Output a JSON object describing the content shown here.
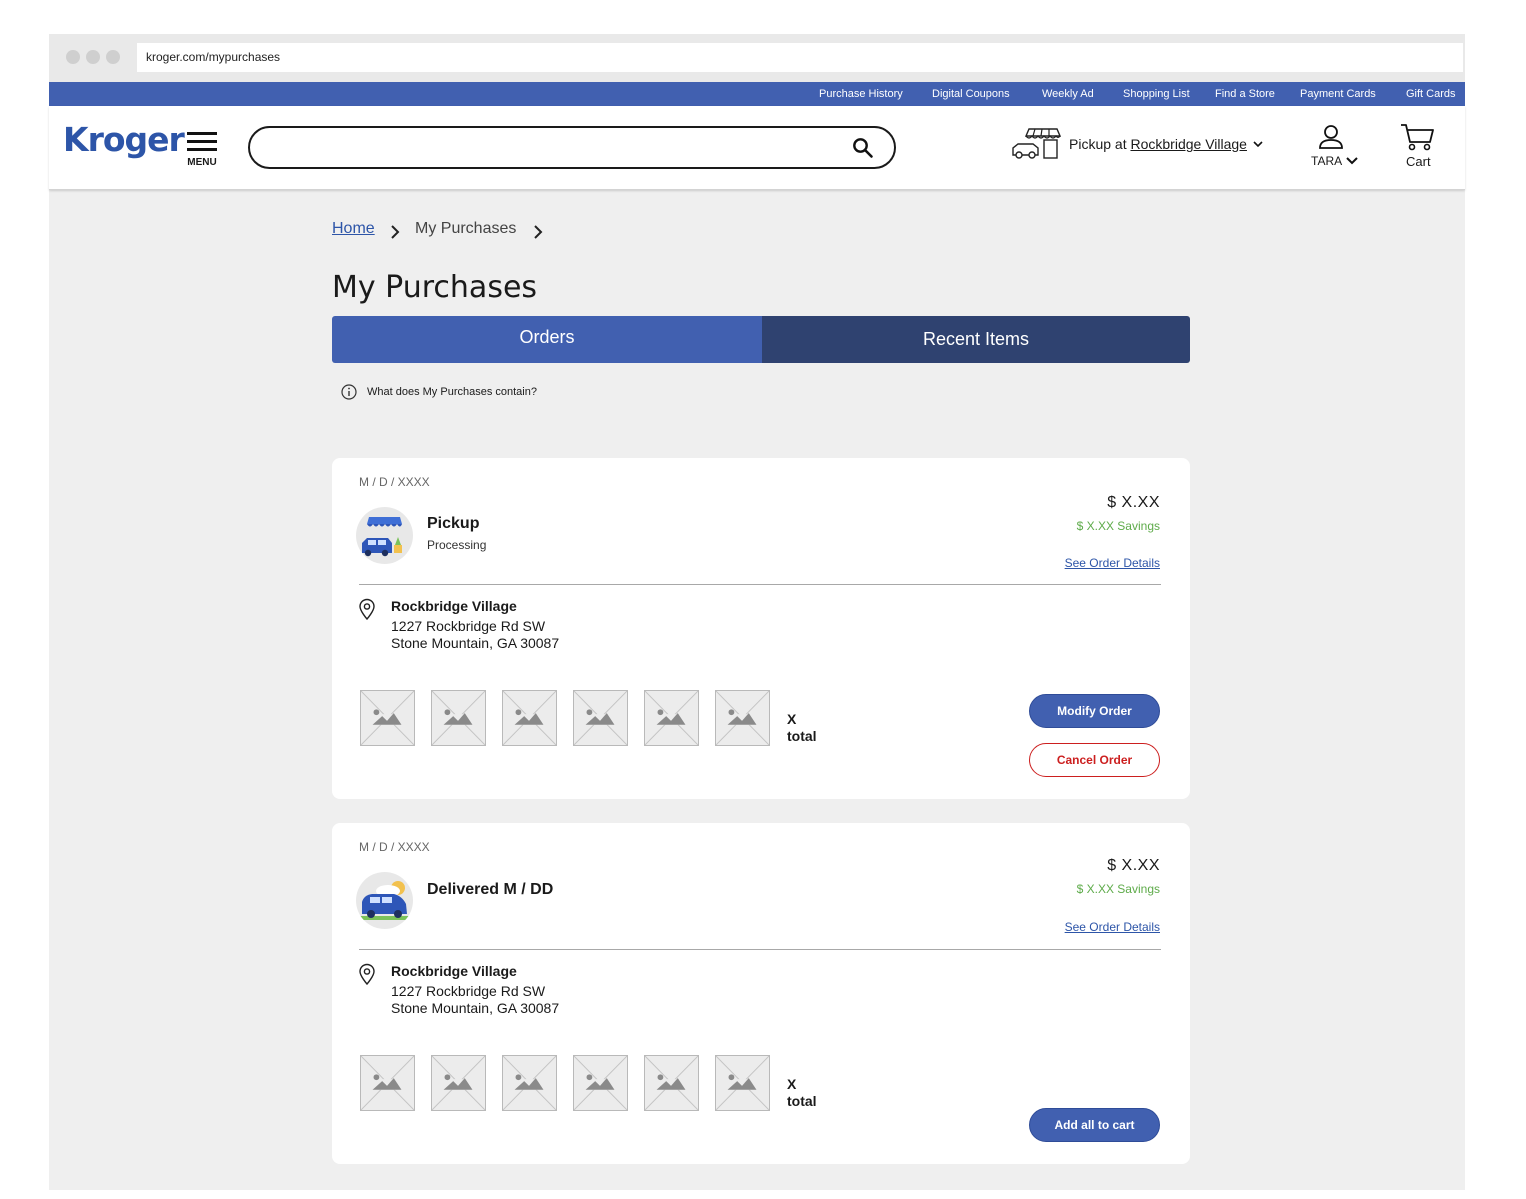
{
  "browser": {
    "url": "kroger.com/mypurchases"
  },
  "utility_nav": {
    "links": [
      "Purchase History",
      "Digital Coupons",
      "Weekly Ad",
      "Shopping List",
      "Find a Store",
      "Payment Cards",
      "Gift Cards"
    ]
  },
  "header": {
    "logo_text": "Kroger",
    "menu_label": "MENU",
    "search_value": "",
    "pickup_prefix": "Pickup at ",
    "pickup_store": "Rockbridge Village",
    "account_label": "TARA",
    "cart_label": "Cart"
  },
  "breadcrumb": {
    "home": "Home",
    "current": "My Purchases"
  },
  "page": {
    "title": "My Purchases",
    "info_text": "What does My Purchases contain?"
  },
  "tabs": [
    {
      "label": "Orders",
      "active": true
    },
    {
      "label": "Recent Items",
      "active": false
    }
  ],
  "orders": [
    {
      "date": "M / D / XXXX",
      "type": "Pickup",
      "status": "Processing",
      "total": "$ X.XX",
      "savings": "$ X.XX Savings",
      "details_link": "See Order Details",
      "store_name": "Rockbridge Village",
      "address_line1": "1227 Rockbridge Rd SW",
      "address_line2": "Stone Mountain, GA 30087",
      "item_count": "X",
      "item_count_suffix": "total",
      "buttons": [
        "Modify Order",
        "Cancel Order"
      ]
    },
    {
      "date": "M / D / XXXX",
      "type": "Delivered M / DD",
      "status": "",
      "total": "$ X.XX",
      "savings": "$ X.XX Savings",
      "details_link": "See Order Details",
      "store_name": "Rockbridge Village",
      "address_line1": "1227 Rockbridge Rd SW",
      "address_line2": "Stone Mountain, GA 30087",
      "item_count": "X",
      "item_count_suffix": "total",
      "buttons": [
        "Add all to cart"
      ]
    }
  ],
  "colors": {
    "brand_blue": "#4160b0",
    "dark_navy": "#2f4270",
    "savings_green": "#5eab4a",
    "danger_red": "#cc1f1f",
    "page_bg": "#efefef"
  }
}
